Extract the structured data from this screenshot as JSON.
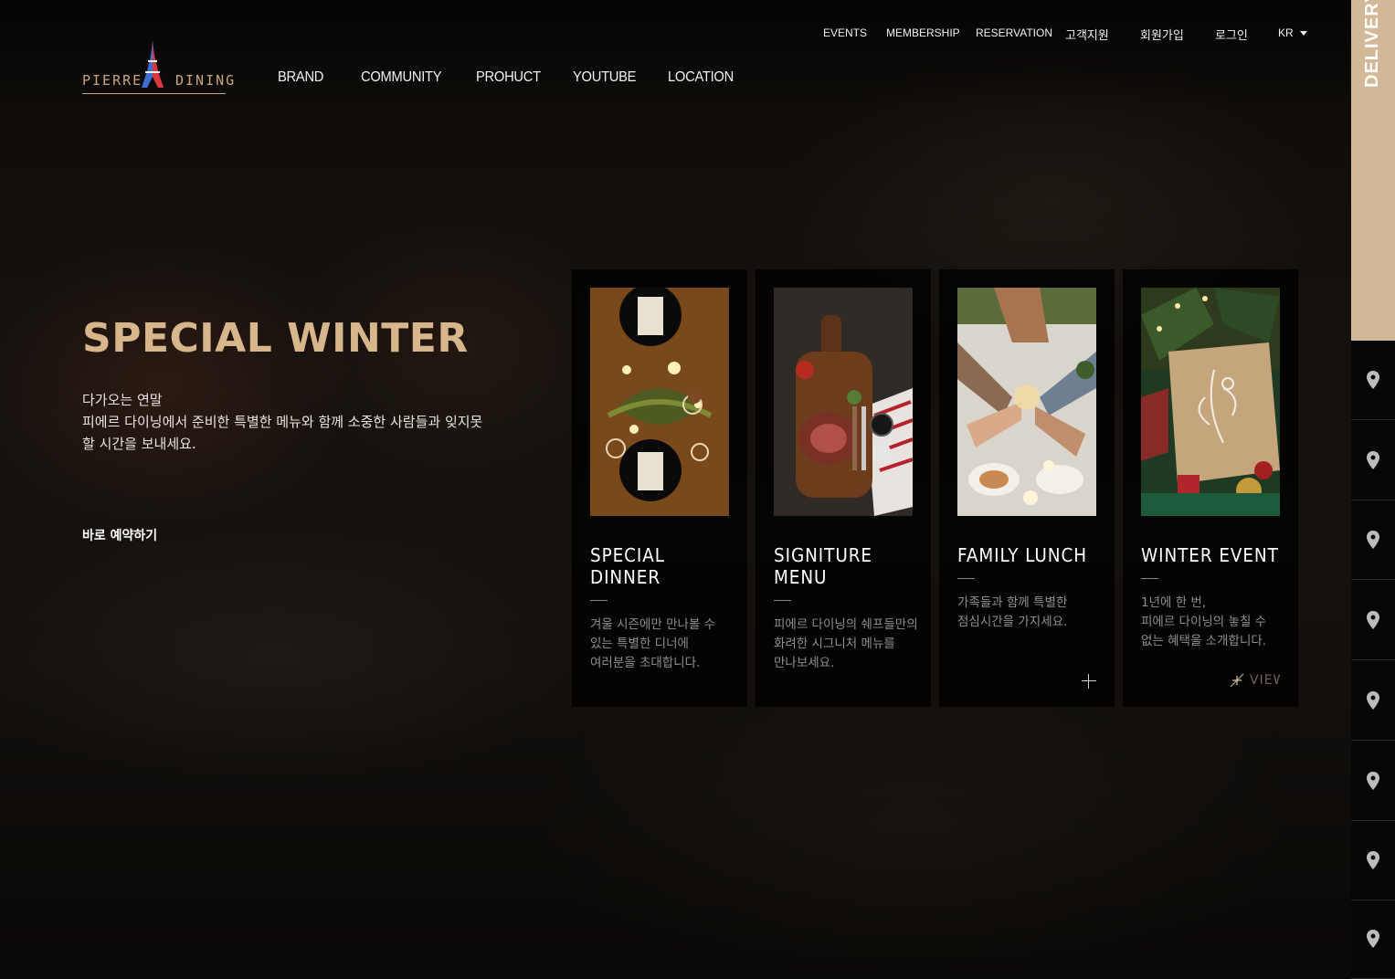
{
  "logo": {
    "left_word": "PIERRE",
    "right_word": "DINING"
  },
  "main_nav": [
    "BRAND",
    "COMMUNITY",
    "PROHUCT",
    "YOUTUBE",
    "LOCATION"
  ],
  "util_nav": [
    "EVENTS",
    "MEMBERSHIP",
    "RESERVATION",
    "고객지원",
    "회원가입",
    "로그인"
  ],
  "language": {
    "selected": "KR"
  },
  "hero": {
    "title": "SPECIAL WINTER",
    "desc_lines": [
      "다가오는 연말",
      "피에르 다이닝에서 준비한 특별한 메뉴와 함께 소중한 사람들과 잊지못",
      "할 시간을 보내세요."
    ],
    "cta": "바로 예약하기"
  },
  "cards": [
    {
      "title": "SPECIAL DINNER",
      "desc": "겨울 시즌에만 만나볼 수 있는 특별한 디너에 여러분을 초대합니다."
    },
    {
      "title": "SIGNITURE MENU",
      "desc": "피에르 다이닝의 쉐프들만의 화려한 시그니처 메뉴를 만나보세요."
    },
    {
      "title": "FAMILY LUNCH",
      "desc": "가족들과 함께 특별한 점심시간을 가지세요."
    },
    {
      "title": "WINTER EVENT",
      "desc_lines": [
        "1년에 한 번,",
        "피에르 다이닝의 놓칠 수 없는 혜택을 소개합니다."
      ],
      "view_label": "VIEW"
    }
  ],
  "sidebar": {
    "delivery_label": "DELIVERY",
    "location_icons": 8
  },
  "colors": {
    "accent": "#d2b896",
    "title_gold": "#d8b68c",
    "logo_gold": "#c9a57a",
    "card_text": "#8e8e8e"
  }
}
